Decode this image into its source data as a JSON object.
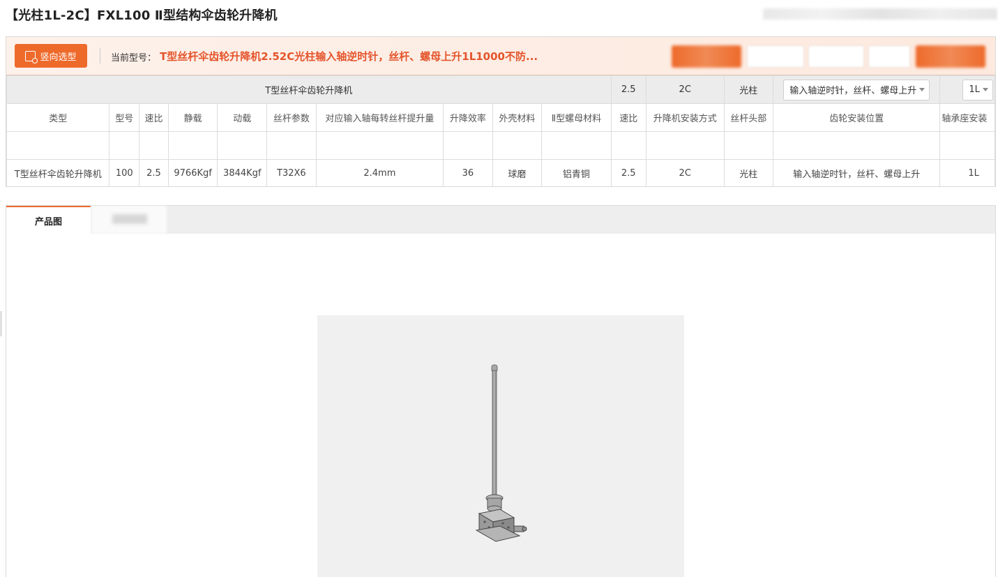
{
  "page": {
    "title": "【光柱1L-2C】FXL100 Ⅱ型结构伞齿轮升降机"
  },
  "model_bar": {
    "select_button_label": "竖向选型",
    "current_label": "当前型号：",
    "current_value": "T型丝杆伞齿轮升降机2.52C光柱输入轴逆时针，丝杆、螺母上升1L1000不防..."
  },
  "selector_row": {
    "type": "T型丝杆伞齿轮升降机",
    "ratio": "2.5",
    "install": "2C",
    "screw_head": "光柱",
    "gear_position": "输入轴逆时针，丝杆、螺母上升",
    "bearing": "1L"
  },
  "table": {
    "headers": [
      "类型",
      "型号",
      "速比",
      "静载",
      "动载",
      "丝杆参数",
      "对应输入轴每转丝杆提升量",
      "升降效率",
      "外壳材料",
      "Ⅱ型螺母材料",
      "速比",
      "升降机安装方式",
      "丝杆头部",
      "齿轮安装位置",
      "轴承座安装"
    ],
    "rows": [
      [
        "T型丝杆伞齿轮升降机",
        "100",
        "2.5",
        "9766Kgf",
        "3844Kgf",
        "T32X6",
        "2.4mm",
        "36",
        "球磨",
        "铝青铜",
        "2.5",
        "2C",
        "光柱",
        "输入轴逆时针，丝杆、螺母上升",
        "1L"
      ]
    ]
  },
  "tabs": {
    "active_label": "产品图"
  },
  "colors": {
    "accent": "#ee6a2b",
    "model_text": "#e4542b",
    "bar_bg": "#fdece2"
  },
  "icons": {
    "select_button": "selection-icon",
    "dropdown": "chevron-down-icon"
  }
}
